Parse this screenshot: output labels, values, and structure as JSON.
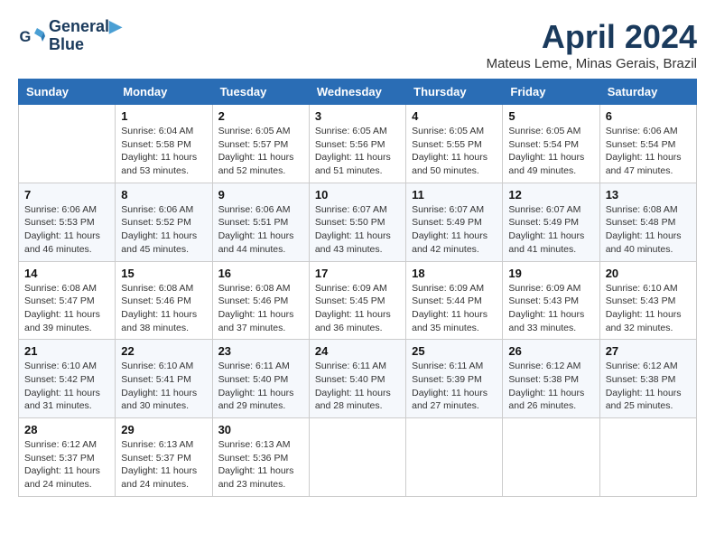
{
  "logo": {
    "line1": "General",
    "line2": "Blue"
  },
  "title": "April 2024",
  "subtitle": "Mateus Leme, Minas Gerais, Brazil",
  "days_of_week": [
    "Sunday",
    "Monday",
    "Tuesday",
    "Wednesday",
    "Thursday",
    "Friday",
    "Saturday"
  ],
  "weeks": [
    [
      {
        "day": "",
        "info": ""
      },
      {
        "day": "1",
        "info": "Sunrise: 6:04 AM\nSunset: 5:58 PM\nDaylight: 11 hours\nand 53 minutes."
      },
      {
        "day": "2",
        "info": "Sunrise: 6:05 AM\nSunset: 5:57 PM\nDaylight: 11 hours\nand 52 minutes."
      },
      {
        "day": "3",
        "info": "Sunrise: 6:05 AM\nSunset: 5:56 PM\nDaylight: 11 hours\nand 51 minutes."
      },
      {
        "day": "4",
        "info": "Sunrise: 6:05 AM\nSunset: 5:55 PM\nDaylight: 11 hours\nand 50 minutes."
      },
      {
        "day": "5",
        "info": "Sunrise: 6:05 AM\nSunset: 5:54 PM\nDaylight: 11 hours\nand 49 minutes."
      },
      {
        "day": "6",
        "info": "Sunrise: 6:06 AM\nSunset: 5:54 PM\nDaylight: 11 hours\nand 47 minutes."
      }
    ],
    [
      {
        "day": "7",
        "info": "Sunrise: 6:06 AM\nSunset: 5:53 PM\nDaylight: 11 hours\nand 46 minutes."
      },
      {
        "day": "8",
        "info": "Sunrise: 6:06 AM\nSunset: 5:52 PM\nDaylight: 11 hours\nand 45 minutes."
      },
      {
        "day": "9",
        "info": "Sunrise: 6:06 AM\nSunset: 5:51 PM\nDaylight: 11 hours\nand 44 minutes."
      },
      {
        "day": "10",
        "info": "Sunrise: 6:07 AM\nSunset: 5:50 PM\nDaylight: 11 hours\nand 43 minutes."
      },
      {
        "day": "11",
        "info": "Sunrise: 6:07 AM\nSunset: 5:49 PM\nDaylight: 11 hours\nand 42 minutes."
      },
      {
        "day": "12",
        "info": "Sunrise: 6:07 AM\nSunset: 5:49 PM\nDaylight: 11 hours\nand 41 minutes."
      },
      {
        "day": "13",
        "info": "Sunrise: 6:08 AM\nSunset: 5:48 PM\nDaylight: 11 hours\nand 40 minutes."
      }
    ],
    [
      {
        "day": "14",
        "info": "Sunrise: 6:08 AM\nSunset: 5:47 PM\nDaylight: 11 hours\nand 39 minutes."
      },
      {
        "day": "15",
        "info": "Sunrise: 6:08 AM\nSunset: 5:46 PM\nDaylight: 11 hours\nand 38 minutes."
      },
      {
        "day": "16",
        "info": "Sunrise: 6:08 AM\nSunset: 5:46 PM\nDaylight: 11 hours\nand 37 minutes."
      },
      {
        "day": "17",
        "info": "Sunrise: 6:09 AM\nSunset: 5:45 PM\nDaylight: 11 hours\nand 36 minutes."
      },
      {
        "day": "18",
        "info": "Sunrise: 6:09 AM\nSunset: 5:44 PM\nDaylight: 11 hours\nand 35 minutes."
      },
      {
        "day": "19",
        "info": "Sunrise: 6:09 AM\nSunset: 5:43 PM\nDaylight: 11 hours\nand 33 minutes."
      },
      {
        "day": "20",
        "info": "Sunrise: 6:10 AM\nSunset: 5:43 PM\nDaylight: 11 hours\nand 32 minutes."
      }
    ],
    [
      {
        "day": "21",
        "info": "Sunrise: 6:10 AM\nSunset: 5:42 PM\nDaylight: 11 hours\nand 31 minutes."
      },
      {
        "day": "22",
        "info": "Sunrise: 6:10 AM\nSunset: 5:41 PM\nDaylight: 11 hours\nand 30 minutes."
      },
      {
        "day": "23",
        "info": "Sunrise: 6:11 AM\nSunset: 5:40 PM\nDaylight: 11 hours\nand 29 minutes."
      },
      {
        "day": "24",
        "info": "Sunrise: 6:11 AM\nSunset: 5:40 PM\nDaylight: 11 hours\nand 28 minutes."
      },
      {
        "day": "25",
        "info": "Sunrise: 6:11 AM\nSunset: 5:39 PM\nDaylight: 11 hours\nand 27 minutes."
      },
      {
        "day": "26",
        "info": "Sunrise: 6:12 AM\nSunset: 5:38 PM\nDaylight: 11 hours\nand 26 minutes."
      },
      {
        "day": "27",
        "info": "Sunrise: 6:12 AM\nSunset: 5:38 PM\nDaylight: 11 hours\nand 25 minutes."
      }
    ],
    [
      {
        "day": "28",
        "info": "Sunrise: 6:12 AM\nSunset: 5:37 PM\nDaylight: 11 hours\nand 24 minutes."
      },
      {
        "day": "29",
        "info": "Sunrise: 6:13 AM\nSunset: 5:37 PM\nDaylight: 11 hours\nand 24 minutes."
      },
      {
        "day": "30",
        "info": "Sunrise: 6:13 AM\nSunset: 5:36 PM\nDaylight: 11 hours\nand 23 minutes."
      },
      {
        "day": "",
        "info": ""
      },
      {
        "day": "",
        "info": ""
      },
      {
        "day": "",
        "info": ""
      },
      {
        "day": "",
        "info": ""
      }
    ]
  ]
}
